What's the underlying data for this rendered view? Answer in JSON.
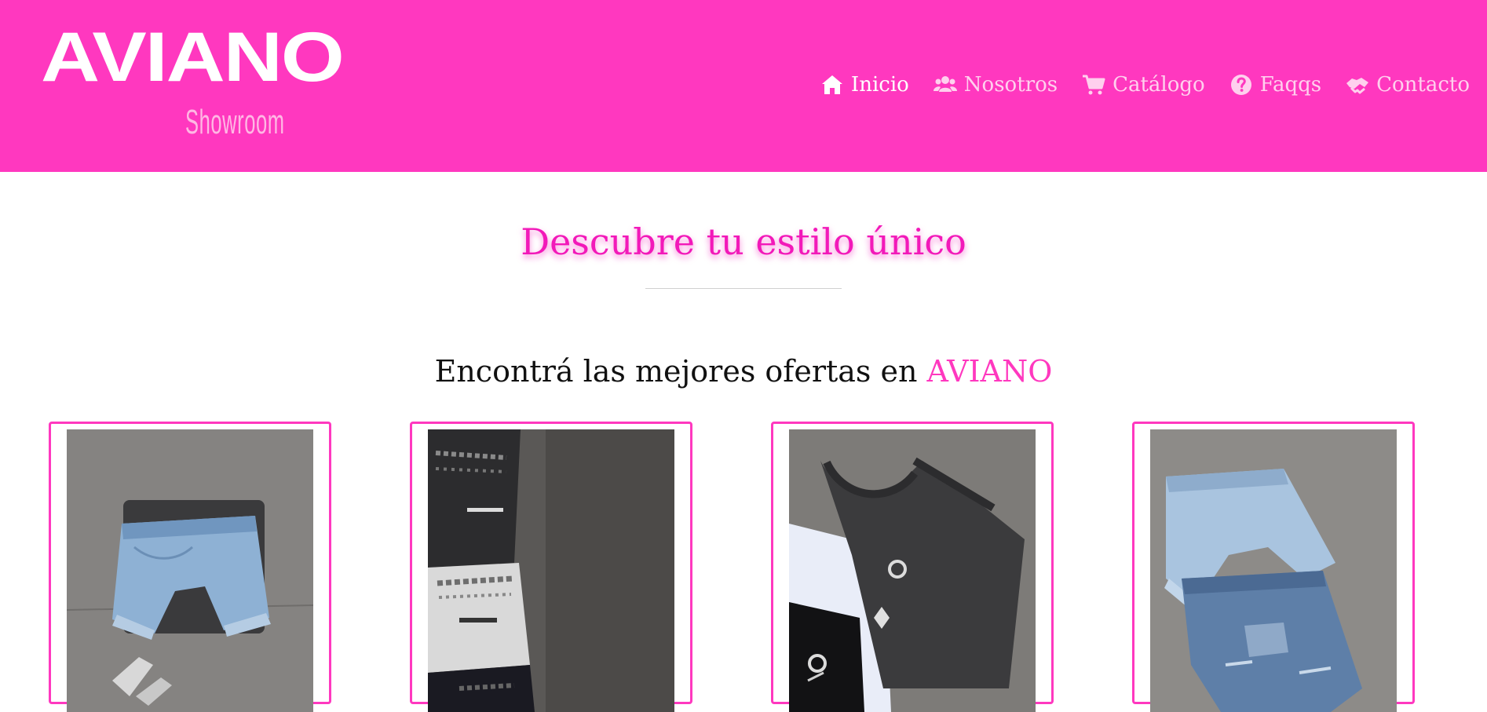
{
  "header": {
    "logo": {
      "main": "AVIANO",
      "sub": "Showroom"
    },
    "nav": [
      {
        "label": "Inicio",
        "icon": "home-icon",
        "active": true
      },
      {
        "label": "Nosotros",
        "icon": "users-icon",
        "active": false
      },
      {
        "label": "Catálogo",
        "icon": "cart-icon",
        "active": false
      },
      {
        "label": "Faqqs",
        "icon": "question-circle-icon",
        "active": false
      },
      {
        "label": "Contacto",
        "icon": "handshake-icon",
        "active": false
      }
    ]
  },
  "hero": {
    "title": "Descubre tu estilo único"
  },
  "offers": {
    "text": "Encontrá las mejores ofertas en ",
    "brand": "AVIANO"
  },
  "products": [
    {
      "image": "denim-shorts-photo"
    },
    {
      "image": "printed-tshirts-photo"
    },
    {
      "image": "tank-tops-photo"
    },
    {
      "image": "two-denim-shorts-photo"
    }
  ],
  "colors": {
    "brand_pink": "#ff38bf",
    "title_pink": "#f219b9",
    "nav_text": "#ffd0ee",
    "nav_active": "#ffffff"
  }
}
